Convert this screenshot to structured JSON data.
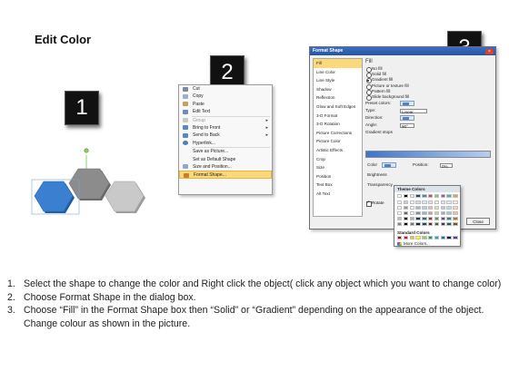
{
  "title": "Edit Color",
  "badges": [
    "1",
    "2",
    "3"
  ],
  "hexagon_colors": {
    "blue": "#3a7fd0",
    "dark_gray": "#8c8c8c",
    "light_gray": "#c9c9c9"
  },
  "context_menu": {
    "items": [
      {
        "label": "Cut",
        "icon": "scissors-icon",
        "disabled": false
      },
      {
        "label": "Copy",
        "icon": "copy-icon",
        "disabled": false
      },
      {
        "label": "Paste",
        "icon": "paste-icon",
        "disabled": false
      },
      {
        "label": "Edit Text",
        "icon": "edit-text-icon",
        "disabled": false
      },
      {
        "label": "Group",
        "icon": "group-icon",
        "disabled": true,
        "submenu": true
      },
      {
        "label": "Bring to Front",
        "icon": "bring-front-icon",
        "disabled": false,
        "submenu": true
      },
      {
        "label": "Send to Back",
        "icon": "send-back-icon",
        "disabled": false,
        "submenu": true
      },
      {
        "label": "Hyperlink...",
        "icon": "hyperlink-icon",
        "disabled": false
      },
      {
        "label": "Save as Picture...",
        "icon": "",
        "disabled": false
      },
      {
        "label": "Set as Default Shape",
        "icon": "",
        "disabled": false
      },
      {
        "label": "Size and Position...",
        "icon": "size-icon",
        "disabled": false
      },
      {
        "label": "Format Shape...",
        "icon": "format-shape-icon",
        "disabled": false,
        "highlighted": true
      }
    ]
  },
  "dialog": {
    "title": "Format Shape",
    "sidebar": [
      "Fill",
      "Line Color",
      "Line Style",
      "Shadow",
      "Reflection",
      "Glow and Soft Edges",
      "3-D Format",
      "3-D Rotation",
      "Picture Corrections",
      "Picture Color",
      "Artistic Effects",
      "Crop",
      "Size",
      "Position",
      "Text Box",
      "Alt Text"
    ],
    "heading": "Fill",
    "fill_options": [
      {
        "label": "No fill",
        "on": false
      },
      {
        "label": "Solid fill",
        "on": false
      },
      {
        "label": "Gradient fill",
        "on": true
      },
      {
        "label": "Picture or texture fill",
        "on": false
      },
      {
        "label": "Pattern fill",
        "on": false
      }
    ],
    "slide_background": "Slide background fill",
    "preset_label": "Preset colors:",
    "type_label": "Type:",
    "type_value": "Linear",
    "direction_label": "Direction:",
    "angle_label": "Angle:",
    "angle_value": "90°",
    "gradient_stops_label": "Gradient stops",
    "color_label": "Color",
    "position_label": "Position:",
    "position_value": "0%",
    "brightness_label": "Brightness",
    "transparency_label": "Transparency",
    "rotate_label": "Rotate",
    "close_label": "Close"
  },
  "color_popup": {
    "theme_label": "Theme Colors",
    "standard_label": "Standard Colors",
    "more_label": "More Colors...",
    "theme_columns": [
      "#ffffff",
      "#000000",
      "#eeece1",
      "#1f497d",
      "#4f81bd",
      "#c0504d",
      "#9bbb59",
      "#8064a2",
      "#4bacc6",
      "#f79646"
    ],
    "standard": [
      "#c00000",
      "#ff0000",
      "#ffc000",
      "#ffff00",
      "#92d050",
      "#00b050",
      "#00b0f0",
      "#0070c0",
      "#002060",
      "#7030a0"
    ]
  },
  "instructions": [
    {
      "num": "1.",
      "text": "Select the shape to change the color and Right click the object( click any object which you want to change color)"
    },
    {
      "num": "2.",
      "text": "Choose Format Shape in the dialog box."
    },
    {
      "num": "3.",
      "text": "Choose “Fill” in the Format Shape box then “Solid” or “Gradient” depending on the appearance of the object. Change colour as shown in the picture."
    }
  ]
}
